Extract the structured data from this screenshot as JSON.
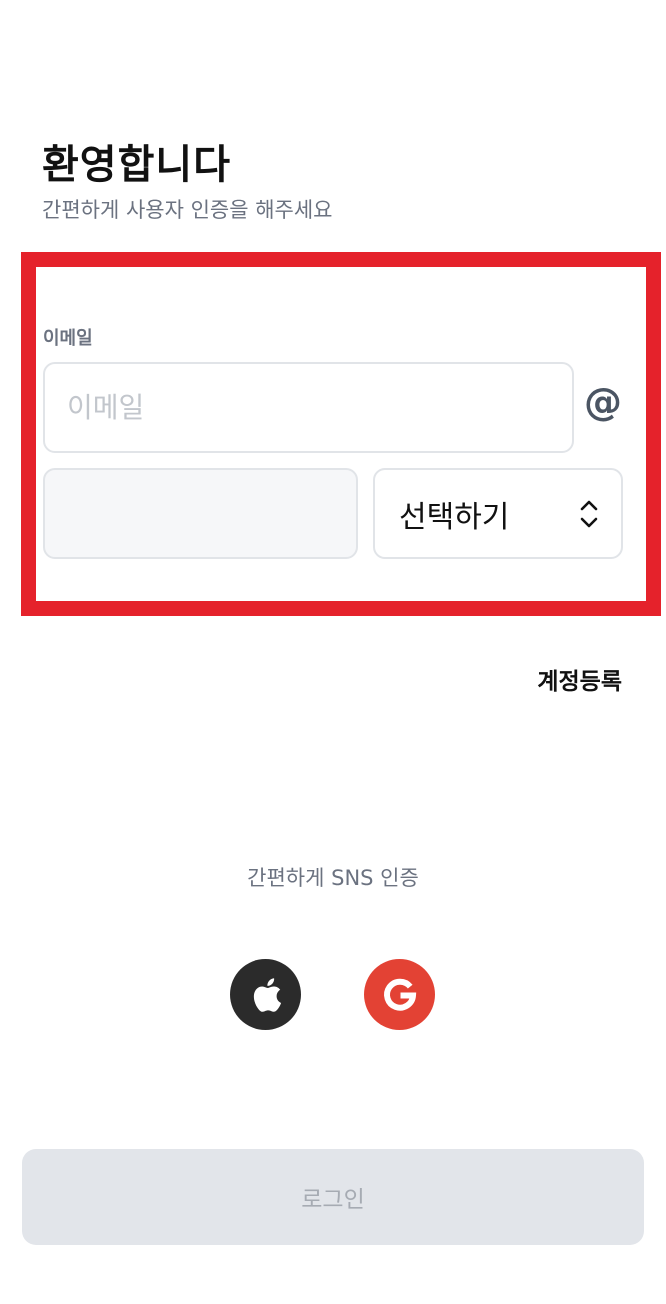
{
  "header": {
    "title": "환영합니다",
    "subtitle": "간편하게 사용자 인증을 해주세요"
  },
  "email_section": {
    "label": "이메일",
    "email_placeholder": "이메일",
    "email_value": "",
    "at_symbol": "@",
    "domain_value": "",
    "domain_select_label": "선택하기"
  },
  "register_link": "계정등록",
  "sns": {
    "caption": "간편하게 SNS 인증",
    "apple_icon": "apple-icon",
    "google_icon": "google-icon",
    "apple_color": "#2b2b2b",
    "google_color": "#e34234"
  },
  "login_button": "로그인",
  "colors": {
    "highlight": "#e5222b",
    "disabled_button": "#e2e5ea",
    "muted_text": "#6b7280"
  }
}
